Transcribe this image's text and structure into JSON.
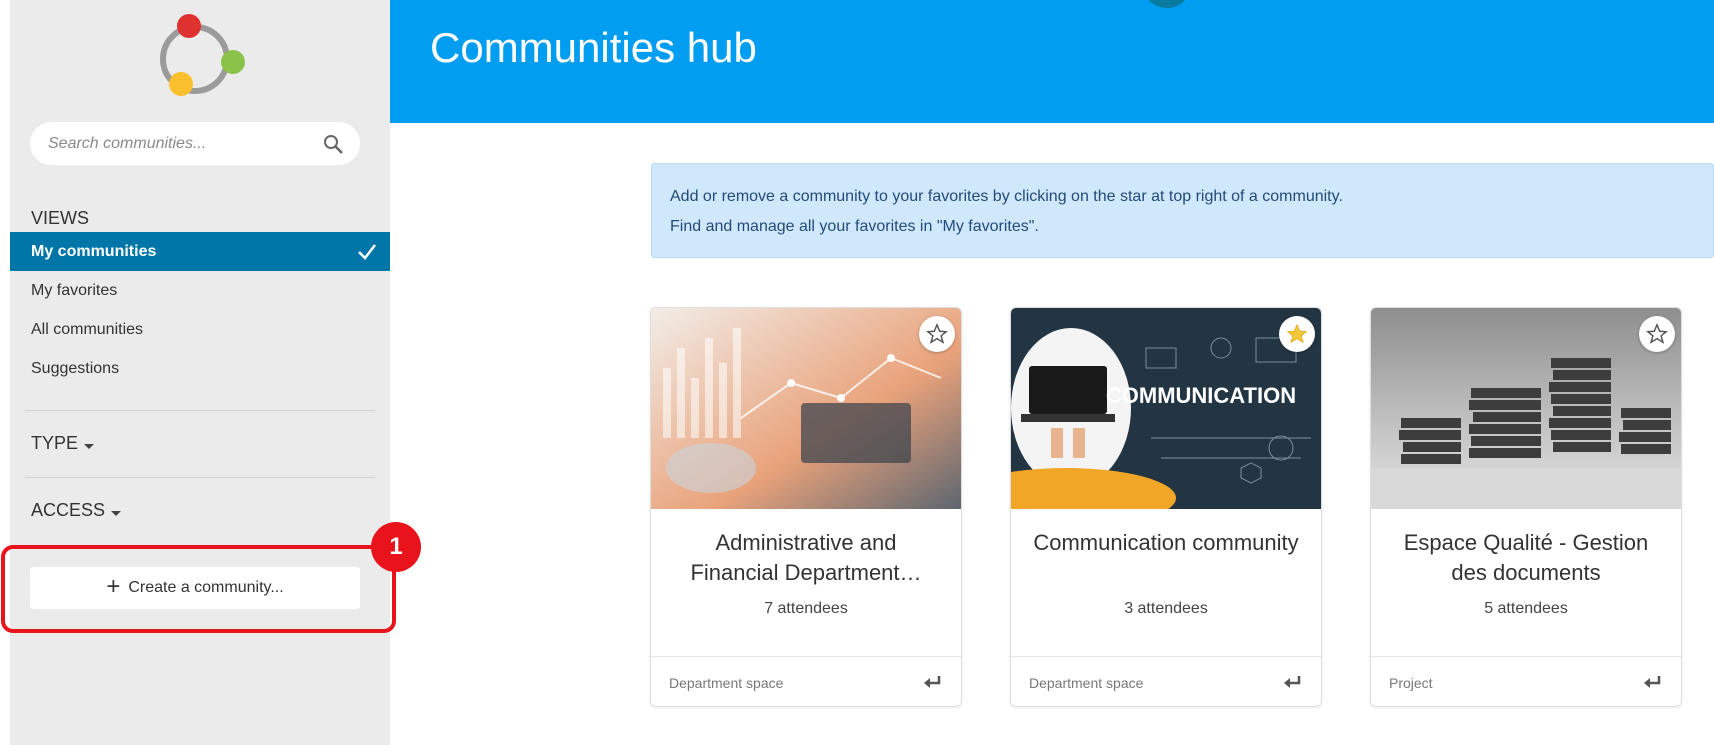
{
  "sidebar": {
    "search_placeholder": "Search communities...",
    "views_title": "VIEWS",
    "views": [
      {
        "label": "My communities",
        "active": true
      },
      {
        "label": "My favorites",
        "active": false
      },
      {
        "label": "All communities",
        "active": false
      },
      {
        "label": "Suggestions",
        "active": false
      }
    ],
    "filters": {
      "type_label": "TYPE",
      "access_label": "ACCESS"
    },
    "create_label": "Create a community...",
    "step_marker": "1"
  },
  "header": {
    "title": "Communities hub"
  },
  "info": {
    "line1": "Add or remove a community to your favorites by clicking on the star at top right of a community.",
    "line2": "Find and manage all your favorites in \"My favorites\"."
  },
  "cards": [
    {
      "title": "Administrative and Financial Department…",
      "attendees": "7 attendees",
      "type": "Department space",
      "favorite": false
    },
    {
      "title": "Communication community",
      "attendees": "3 attendees",
      "type": "Department space",
      "favorite": true
    },
    {
      "title": "Espace Qualité - Gestion des documents",
      "attendees": "5 attendees",
      "type": "Project",
      "favorite": false
    }
  ],
  "colors": {
    "header": "#009df0",
    "active_nav": "#0076a8",
    "highlight": "#e8131b",
    "favorite_star": "#f6c83b"
  }
}
